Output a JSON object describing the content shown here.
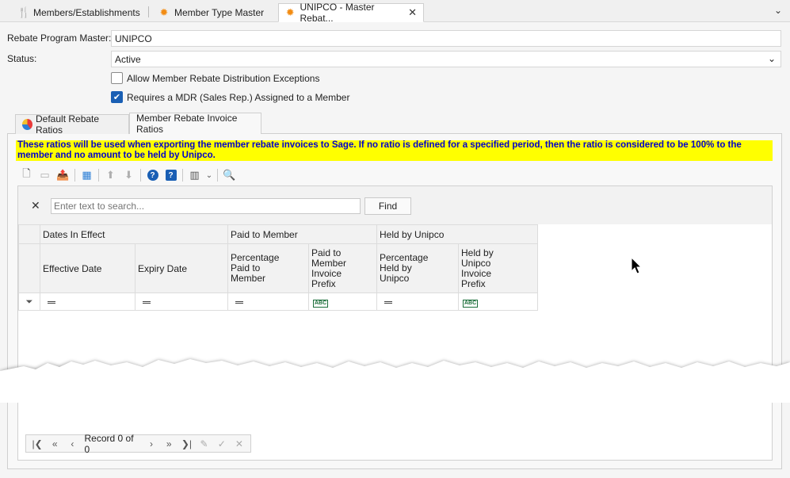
{
  "doc_tabs": [
    {
      "label": "Members/Establishments",
      "icon": "fork-knife-icon"
    },
    {
      "label": "Member Type Master",
      "icon": "gear-icon"
    },
    {
      "label": "UNIPCO - Master Rebat...",
      "icon": "gear-icon",
      "active": true
    }
  ],
  "form": {
    "rebate_label": "Rebate Program Master:",
    "rebate_value": "UNIPCO",
    "status_label": "Status:",
    "status_value": "Active",
    "allow_exceptions_label": "Allow Member Rebate Distribution Exceptions",
    "allow_exceptions_checked": false,
    "requires_mdr_label": "Requires a MDR (Sales Rep.) Assigned to a Member",
    "requires_mdr_checked": true
  },
  "inner_tabs": {
    "default_label": "Default Rebate Ratios",
    "member_label": "Member Rebate Invoice Ratios"
  },
  "notice_line1": "These ratios will be used when exporting the member rebate invoices to Sage.  If no ratio is defined for a specified period, then the ratio is considered to be 100% to the",
  "notice_line2": "member and no amount to be held by Unipco.",
  "search": {
    "placeholder": "Enter text to search...",
    "find_label": "Find"
  },
  "grid": {
    "band_dates": "Dates In Effect",
    "band_paid": "Paid to Member",
    "band_held": "Held by Unipco",
    "columns": {
      "effective": "Effective Date",
      "expiry": "Expiry Date",
      "pct_paid_1": "Percentage",
      "pct_paid_2": "Paid to",
      "pct_paid_3": "Member",
      "prefix_paid_1": "Paid to",
      "prefix_paid_2": "Member",
      "prefix_paid_3": "Invoice",
      "prefix_paid_4": "Prefix",
      "pct_held_1": "Percentage",
      "pct_held_2": "Held by",
      "pct_held_3": "Unipco",
      "prefix_held_1": "Held by",
      "prefix_held_2": "Unipco",
      "prefix_held_3": "Invoice",
      "prefix_held_4": "Prefix"
    }
  },
  "navigator": {
    "record_text": "Record 0 of 0"
  }
}
